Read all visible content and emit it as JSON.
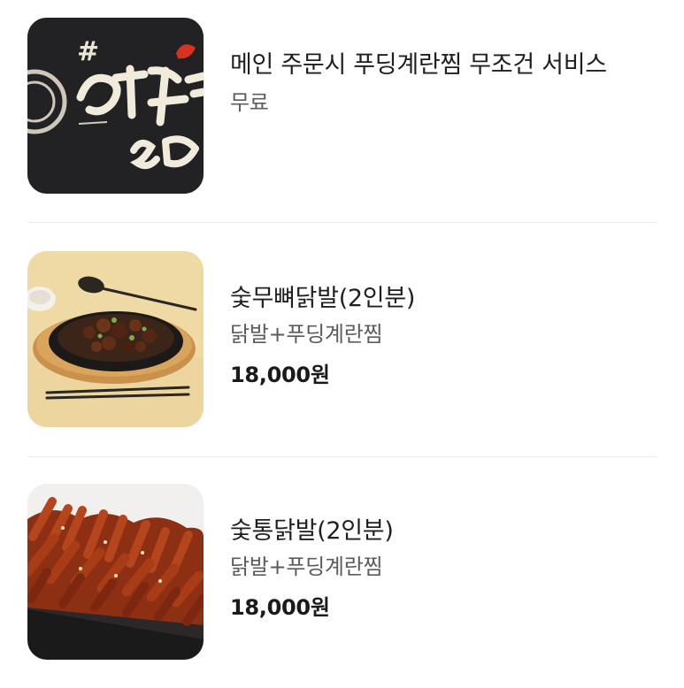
{
  "menu": {
    "items": [
      {
        "name": "메인 주문시 푸딩계란찜 무조건 서비스",
        "price": "무료",
        "image": "restaurant-logo-photo"
      },
      {
        "name": "숯무뼈닭발(2인분)",
        "description": "닭발+푸딩계란찜",
        "price": "18,000원",
        "image": "boneless-chicken-feet-platter-photo"
      },
      {
        "name": "숯통닭발(2인분)",
        "description": "닭발+푸딩계란찜",
        "price": "18,000원",
        "image": "whole-chicken-feet-platter-photo"
      }
    ]
  }
}
